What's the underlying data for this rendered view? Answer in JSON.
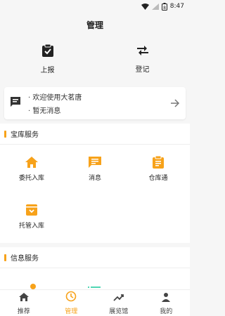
{
  "status_bar": {
    "time": "8:47",
    "battery": "8"
  },
  "header": {
    "title": "管理"
  },
  "quick_actions": [
    {
      "label": "上报",
      "icon": "clipboard-check-icon"
    },
    {
      "label": "登记",
      "icon": "swap-arrows-icon"
    }
  ],
  "notice": {
    "icon": "message-icon",
    "lines": [
      "· 欢迎使用大茗唐",
      "· 暂无消息"
    ],
    "arrow_icon": "arrow-right-icon"
  },
  "sections": [
    {
      "title": "宝库服务",
      "items": [
        {
          "label": "委托入库",
          "icon": "home-icon"
        },
        {
          "label": "消息",
          "icon": "message-icon"
        },
        {
          "label": "仓库通",
          "icon": "clipboard-icon"
        },
        {
          "label": "托管入库",
          "icon": "inbox-icon"
        }
      ]
    },
    {
      "title": "信息服务",
      "items": []
    }
  ],
  "bottom_nav": [
    {
      "label": "推荐",
      "icon": "home-icon",
      "active": false
    },
    {
      "label": "管理",
      "icon": "clock-icon",
      "active": true
    },
    {
      "label": "展览馆",
      "icon": "trend-icon",
      "active": false
    },
    {
      "label": "我的",
      "icon": "person-icon",
      "active": false
    }
  ],
  "colors": {
    "accent": "#f7a21a",
    "teal_partial": "#4fd6b3"
  }
}
